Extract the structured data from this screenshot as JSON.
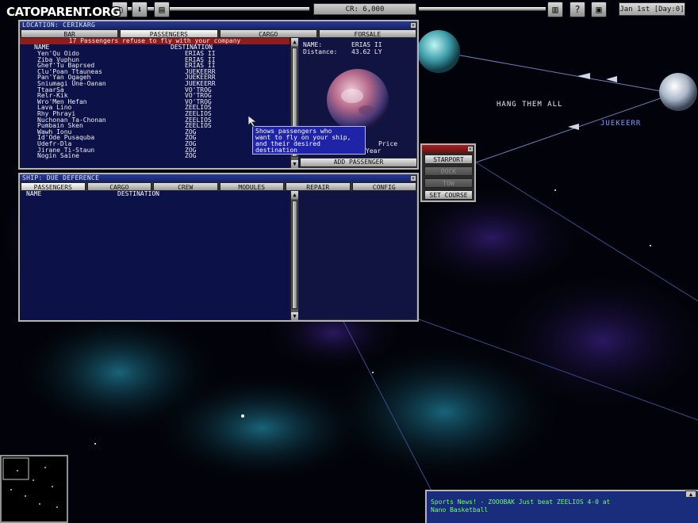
{
  "topbar": {
    "watermark": "CATOPARENT.ORG",
    "credits": "CR: 6,000",
    "date": "Jan 1st [Day:0]"
  },
  "location_window": {
    "title": "LOCATION: CERIKARG",
    "tabs": [
      "BAR",
      "PASSENGERS",
      "CARGO",
      "FORSALE"
    ],
    "active_tab": "PASSENGERS",
    "banner": "17 Passengers refuse to fly with your company",
    "col_name": "NAME",
    "col_destination": "DESTINATION",
    "passengers": [
      {
        "name": "Yen'Qu Oido",
        "destination": "ERIAS II"
      },
      {
        "name": "Ziba Vuphun",
        "destination": "ERIAS II"
      },
      {
        "name": "Ghef'Tu Baprsed",
        "destination": "ERIAS II"
      },
      {
        "name": "Clu'Poan Ttauneas",
        "destination": "JUEKEERR"
      },
      {
        "name": "Pan'Yan Ogageh",
        "destination": "JUEKEERR"
      },
      {
        "name": "Sniumagi Une-Oanan",
        "destination": "JUEKEERR"
      },
      {
        "name": "TtaarSa",
        "destination": "VO'TROG"
      },
      {
        "name": "Relr-Kik",
        "destination": "VO'TROG"
      },
      {
        "name": "Wro'Men Hefan",
        "destination": "VO'TROG"
      },
      {
        "name": "Lava Lino",
        "destination": "ZEELIOS"
      },
      {
        "name": "Rhy Phrayi",
        "destination": "ZEELIOS"
      },
      {
        "name": "Nuchonan Ta-Chonan",
        "destination": "ZEELIOS"
      },
      {
        "name": "Pumbain Sken",
        "destination": "ZEELIOS"
      },
      {
        "name": "Wawh Ionu",
        "destination": "ZOG"
      },
      {
        "name": "Id'Ode Pusaquba",
        "destination": "ZOG"
      },
      {
        "name": "Udefr-Dla",
        "destination": "ZOG"
      },
      {
        "name": "Jirane Ti-Staun",
        "destination": "ZOG"
      },
      {
        "name": "Nogin Saine",
        "destination": "ZOG"
      }
    ],
    "info": {
      "name_label": "NAME:",
      "name_value": "ERIAS II",
      "distance_label": "Distance:",
      "distance_value": "43.62 LY",
      "price_line1": "Price",
      "price_line2": "Year"
    },
    "add_button": "ADD PASSENGER"
  },
  "tooltip": {
    "line1": "Shows passengers who",
    "line2": "want to fly on your ship,",
    "line3": "and their desired",
    "line4": "destination"
  },
  "ship_window": {
    "title": "SHIP: DUE DEFERENCE",
    "tabs": [
      "PASSENGERS",
      "CARGO",
      "CREW",
      "MODULES",
      "REPAIR",
      "CONFIG"
    ],
    "active_tab": "PASSENGERS",
    "col_name": "NAME",
    "col_destination": "DESTINATION"
  },
  "nav_panel": {
    "buttons": [
      "STARPORT",
      "DOCK",
      "TOW",
      "SET COURSE"
    ],
    "enabled": [
      true,
      false,
      false,
      true
    ]
  },
  "space": {
    "label_player": "HANG THEM ALL",
    "label_planet": "JUEKEERR"
  },
  "news": {
    "line1": "Sports News! - ZOOOBAK Just beat ZEELIOS 4-0 at",
    "line2": "Nano Basketball"
  },
  "colors": {
    "window_bg": "#121646",
    "banner_red": "#8f1d1d",
    "tooltip_bg": "#1f23a8",
    "news_text": "#6fff6f",
    "planet_label": "#7f9cff"
  }
}
